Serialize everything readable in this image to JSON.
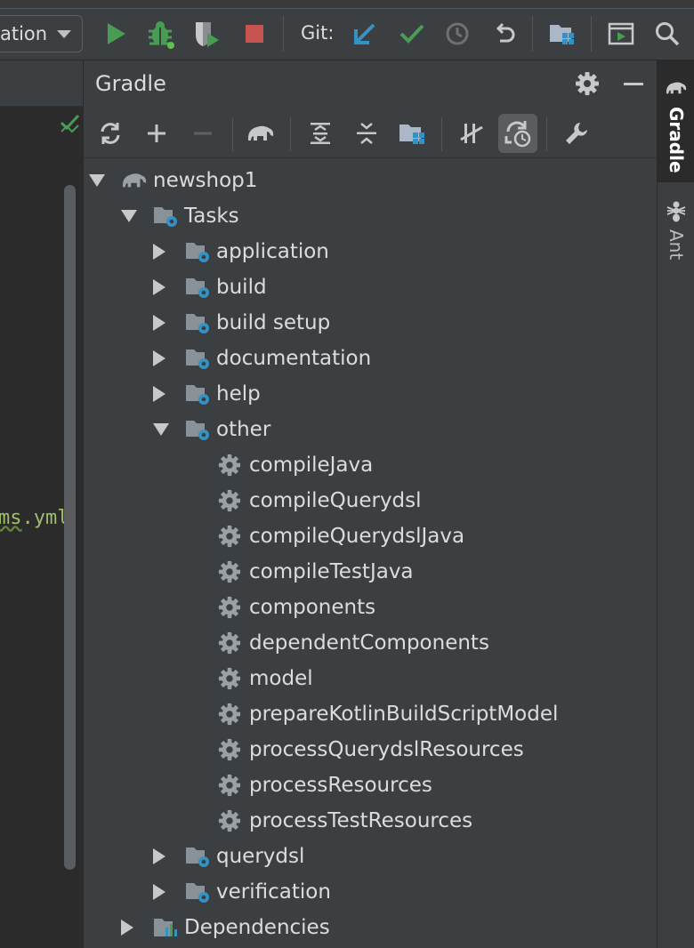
{
  "toolbar": {
    "run_config_label": "ation",
    "git_label": "Git:"
  },
  "editor": {
    "visible_text_prefix": "ms",
    "visible_text_suffix": ".yml"
  },
  "panel": {
    "title": "Gradle"
  },
  "right_strip": {
    "gradle_tab": "Gradle",
    "ant_tab": "Ant"
  },
  "tree": {
    "root": "newshop1",
    "tasks": "Tasks",
    "groups": {
      "application": "application",
      "build": "build",
      "build_setup": "build setup",
      "documentation": "documentation",
      "help": "help",
      "other": "other",
      "querydsl": "querydsl",
      "verification": "verification"
    },
    "other_tasks": [
      "compileJava",
      "compileQuerydsl",
      "compileQuerydslJava",
      "compileTestJava",
      "components",
      "dependentComponents",
      "model",
      "prepareKotlinBuildScriptModel",
      "processQuerydslResources",
      "processResources",
      "processTestResources"
    ],
    "dependencies": "Dependencies"
  },
  "colors": {
    "run_green": "#499c54",
    "stop_red": "#c75450",
    "git_blue": "#3592c4",
    "panel_bg": "#3c3f41",
    "editor_bg": "#2b2b2b",
    "text": "#dcdcdc"
  }
}
